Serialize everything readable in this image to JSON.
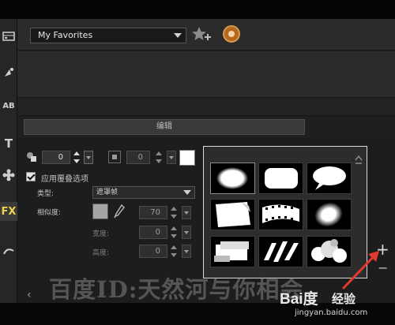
{
  "app": {
    "library": {
      "selected": "My Favorites"
    },
    "edit_tab": "编辑",
    "overlay": {
      "rotation_value": "0",
      "opacity_value": "0",
      "apply_overlay_label": "应用覆叠选项",
      "apply_overlay_checked": true,
      "type_label": "类型:",
      "type_value": "遮罩帧",
      "similarity_label": "相似度:",
      "similarity_value": "70",
      "width_label": "宽度:",
      "width_value": "0",
      "height_label": "高度:",
      "height_value": "0"
    },
    "gallery": {
      "masks": [
        "ellipse-mask",
        "rounded-rect-mask",
        "speech-bubble-mask",
        "torn-paper-mask",
        "film-strip-mask",
        "blurred-oval-mask",
        "brush-rect-mask",
        "stripe-mask",
        "bubbles-mask"
      ]
    },
    "controls": {
      "add": "+",
      "remove": "−",
      "back": "‹"
    },
    "left_tools": [
      "media-icon",
      "transition-icon",
      "title-icon",
      "text-icon",
      "graphic-icon",
      "fx-icon",
      "path-icon"
    ],
    "fx_label": "FX",
    "title_label": "AB",
    "text_label": "T"
  },
  "watermark": {
    "text": "百度ID:天然河与你相会",
    "logo": "Bai度",
    "logo_suffix": "经验",
    "url": "jingyan.baidu.com"
  },
  "colors": {
    "accent_fx": "#f0d24a",
    "arrow": "#e23a2e",
    "white_swatch": "#ffffff",
    "gray_swatch": "#a6a4a4"
  }
}
